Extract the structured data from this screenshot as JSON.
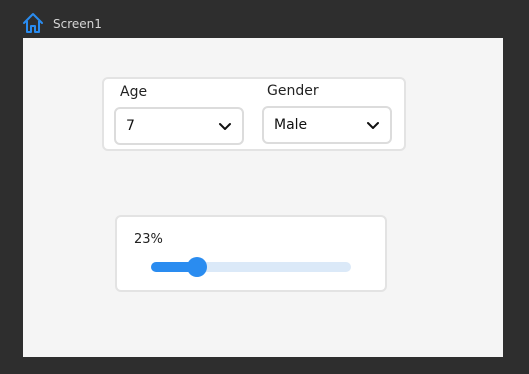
{
  "header": {
    "screen_name": "Screen1",
    "home_icon": "home-icon"
  },
  "form": {
    "age": {
      "label": "Age",
      "value": "7",
      "icon": "chevron-down-icon"
    },
    "gender": {
      "label": "Gender",
      "value": "Male",
      "icon": "chevron-down-icon"
    }
  },
  "progress": {
    "label": "23%",
    "percent": 23
  },
  "colors": {
    "accent": "#2a8cf0",
    "track": "#dbe9f8",
    "home_icon": "#2a8cf0"
  }
}
